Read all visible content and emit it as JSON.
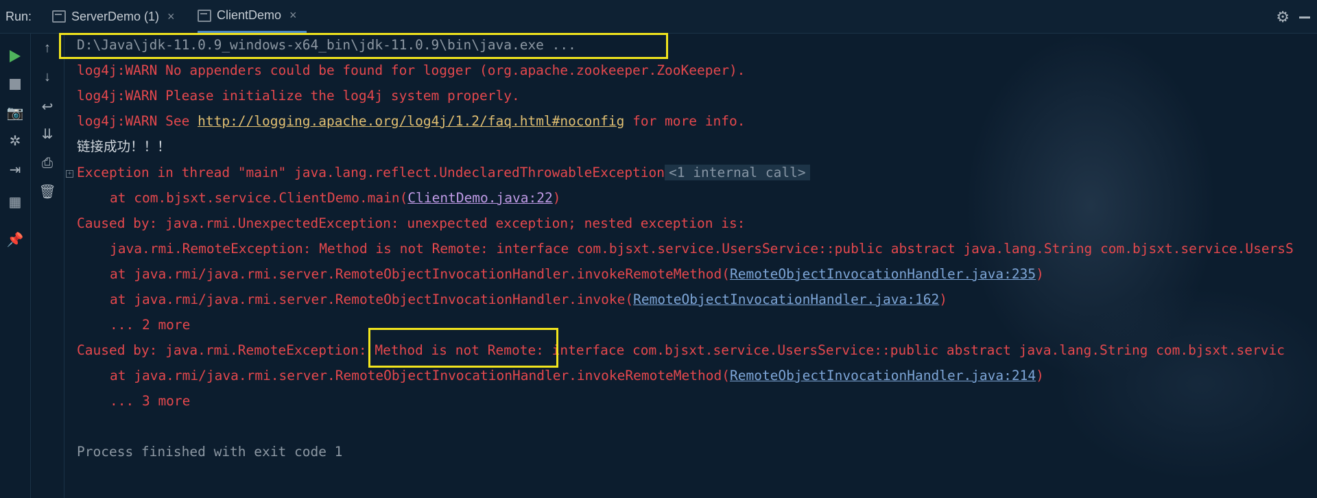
{
  "topbar": {
    "run_label": "Run:",
    "tabs": [
      {
        "label": "ServerDemo (1)",
        "close": "×"
      },
      {
        "label": "ClientDemo",
        "close": "×"
      }
    ],
    "settings_icon": "gear-icon",
    "minimize_icon": "minimize-icon"
  },
  "toolbar": {
    "left_column": [
      "play-icon",
      "stop-icon",
      "camera-icon",
      "debug-bug-icon",
      "login-icon",
      "layout-icon",
      "pin-icon"
    ],
    "right_column": [
      "arrow-up-icon",
      "arrow-down-icon",
      "soft-wrap-icon",
      "scroll-to-end-icon",
      "print-icon",
      "trash-icon"
    ]
  },
  "console": {
    "cmd": "D:\\Java\\jdk-11.0.9_windows-x64_bin\\jdk-11.0.9\\bin\\java.exe ...",
    "warn1": "log4j:WARN No appenders could be found for logger (org.apache.zookeeper.ZooKeeper).",
    "warn2": "log4j:WARN Please initialize the log4j system properly.",
    "warn3_pre": "log4j:WARN See ",
    "warn3_link": "http://logging.apache.org/log4j/1.2/faq.html#noconfig",
    "warn3_post": " for more info.",
    "success": "链接成功！！！",
    "exc": "Exception in thread \"main\" java.lang.reflect.UndeclaredThrowableException",
    "internal": "<1 internal call>",
    "at1_pre": "at com.bjsxt.service.ClientDemo.main(",
    "at1_link": "ClientDemo.java:22",
    "at1_post": ")",
    "caused1": "Caused by: java.rmi.UnexpectedException: unexpected exception; nested exception is:",
    "remote1": "java.rmi.RemoteException: Method is not Remote: interface com.bjsxt.service.UsersService::public abstract java.lang.String com.bjsxt.service.UsersS",
    "at2_pre": "at java.rmi/java.rmi.server.RemoteObjectInvocationHandler.invokeRemoteMethod(",
    "at2_link": "RemoteObjectInvocationHandler.java:235",
    "at2_post": ")",
    "at3_pre": "at java.rmi/java.rmi.server.RemoteObjectInvocationHandler.invoke(",
    "at3_link": "RemoteObjectInvocationHandler.java:162",
    "at3_post": ")",
    "more2": "... 2 more",
    "caused2": "Caused by: java.rmi.RemoteException: Method is not Remote: interface com.bjsxt.service.UsersService::public abstract java.lang.String com.bjsxt.servic",
    "at4_pre": "at java.rmi/java.rmi.server.RemoteObjectInvocationHandler.invokeRemoteMethod(",
    "at4_link": "RemoteObjectInvocationHandler.java:214",
    "at4_post": ")",
    "more3": "... 3 more",
    "exit": "Process finished with exit code 1"
  },
  "colors": {
    "background": "#0c1d2e",
    "error_text": "#e5484d",
    "link_blue": "#7ea6d8",
    "link_yellow": "#e2c072",
    "highlight_box": "#f2e51d",
    "run_green": "#4fb35c"
  }
}
